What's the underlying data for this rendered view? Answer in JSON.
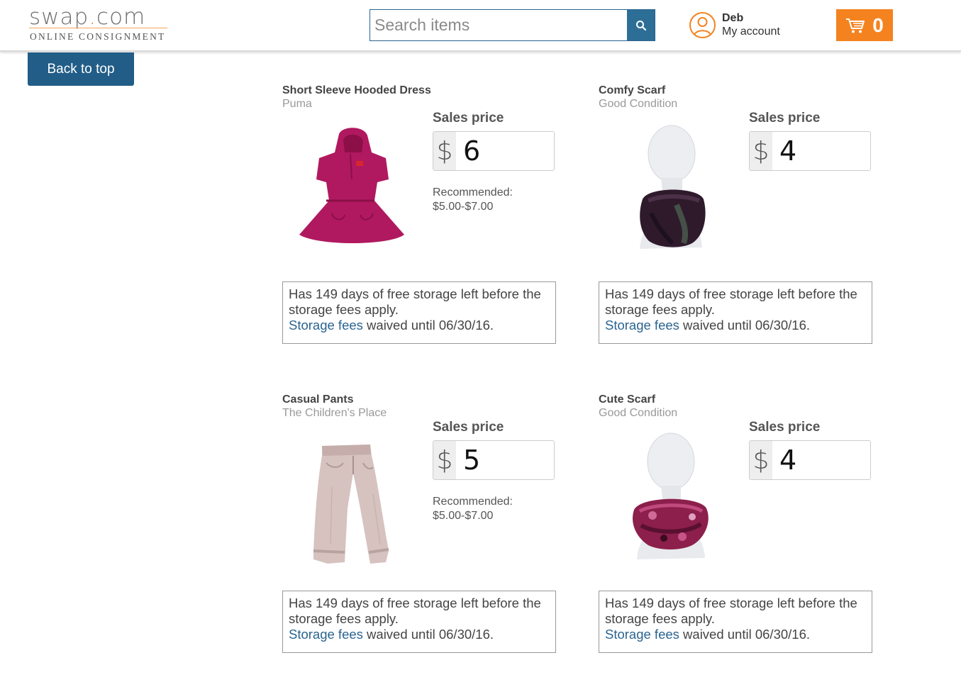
{
  "header": {
    "logo_text": "swap",
    "logo_dot": ".",
    "logo_tld": "com",
    "logo_subtitle": "ONLINE CONSIGNMENT",
    "search_placeholder": "Search items",
    "account_name": "Deb",
    "account_link": "My account",
    "cart_count": "0",
    "colors": {
      "accent": "#f4831f",
      "brand_blue": "#2d6e97"
    }
  },
  "back_to_top": "Back to top",
  "items": [
    {
      "title": "Short Sleeve Hooded Dress",
      "subtitle": "Puma",
      "price_label": "Sales price",
      "currency": "$",
      "price": "6",
      "recommended_label": "Recommended:",
      "recommended_range": "$5.00-$7.00",
      "storage_text": "Has 149 days of free storage left before the storage fees apply.",
      "storage_link": "Storage fees",
      "storage_suffix": " waived until 06/30/16.",
      "image": "pink-hooded-dress"
    },
    {
      "title": "Comfy Scarf",
      "subtitle": "Good Condition",
      "price_label": "Sales price",
      "currency": "$",
      "price": "4",
      "recommended_label": "",
      "recommended_range": "",
      "storage_text": "Has 149 days of free storage left before the storage fees apply.",
      "storage_link": "Storage fees",
      "storage_suffix": " waived until 06/30/16.",
      "image": "dark-scarf-mannequin"
    },
    {
      "title": "Casual Pants",
      "subtitle": "The Children's Place",
      "price_label": "Sales price",
      "currency": "$",
      "price": "5",
      "recommended_label": "Recommended:",
      "recommended_range": "$5.00-$7.00",
      "storage_text": "Has 149 days of free storage left before the storage fees apply.",
      "storage_link": "Storage fees",
      "storage_suffix": " waived until 06/30/16.",
      "image": "beige-pants"
    },
    {
      "title": "Cute Scarf",
      "subtitle": "Good Condition",
      "price_label": "Sales price",
      "currency": "$",
      "price": "4",
      "recommended_label": "",
      "recommended_range": "",
      "storage_text": "Has 149 days of free storage left before the storage fees apply.",
      "storage_link": "Storage fees",
      "storage_suffix": " waived until 06/30/16.",
      "image": "magenta-scarf-mannequin"
    }
  ]
}
